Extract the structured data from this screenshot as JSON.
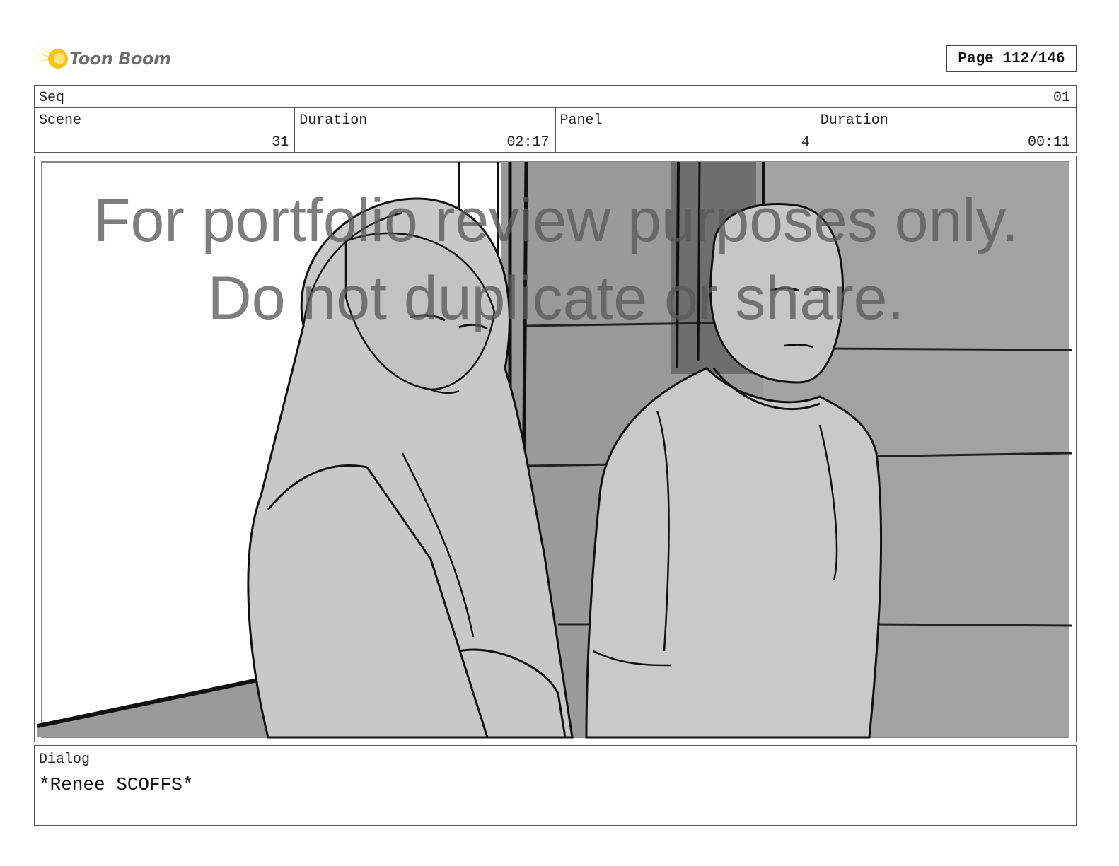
{
  "brand": {
    "logo_icon": "toon-boom-star-icon",
    "name": "Toon Boom",
    "accent": "#f5c518"
  },
  "page_indicator": "Page 112/146",
  "header": {
    "seq_label": "Seq",
    "seq_value": "01",
    "scene_label": "Scene",
    "scene_value": "31",
    "scene_duration_label": "Duration",
    "scene_duration_value": "02:17",
    "panel_label": "Panel",
    "panel_value": "4",
    "panel_duration_label": "Duration",
    "panel_duration_value": "00:11"
  },
  "watermark": {
    "line1": "For portfolio review purposes only.",
    "line2": "Do not duplicate or share."
  },
  "dialog": {
    "label": "Dialog",
    "text": "*Renee SCOFFS*"
  }
}
